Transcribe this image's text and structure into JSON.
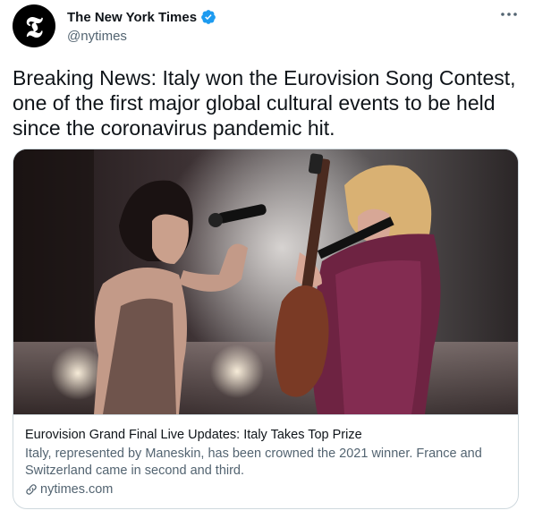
{
  "account": {
    "display_name": "The New York Times",
    "handle": "@nytimes",
    "avatar_glyph": "𝕿",
    "verified": true
  },
  "tweet": {
    "text": "Breaking News: Italy won the Eurovision Song Contest, one of the first major global cultural events to be held since the coronavirus pandemic hit."
  },
  "card": {
    "title": "Eurovision Grand Final Live Updates: Italy Takes Top Prize",
    "description": "Italy, represented by Maneskin, has been crowned the 2021 winner. France and Switzerland came in second and third.",
    "domain": "nytimes.com"
  },
  "icons": {
    "verified": "verified-badge-icon",
    "more": "more-options-icon",
    "link": "link-icon"
  },
  "colors": {
    "verified_blue": "#1d9bf0",
    "text_primary": "#0f1419",
    "text_secondary": "#536471",
    "border": "#cfd9de"
  }
}
